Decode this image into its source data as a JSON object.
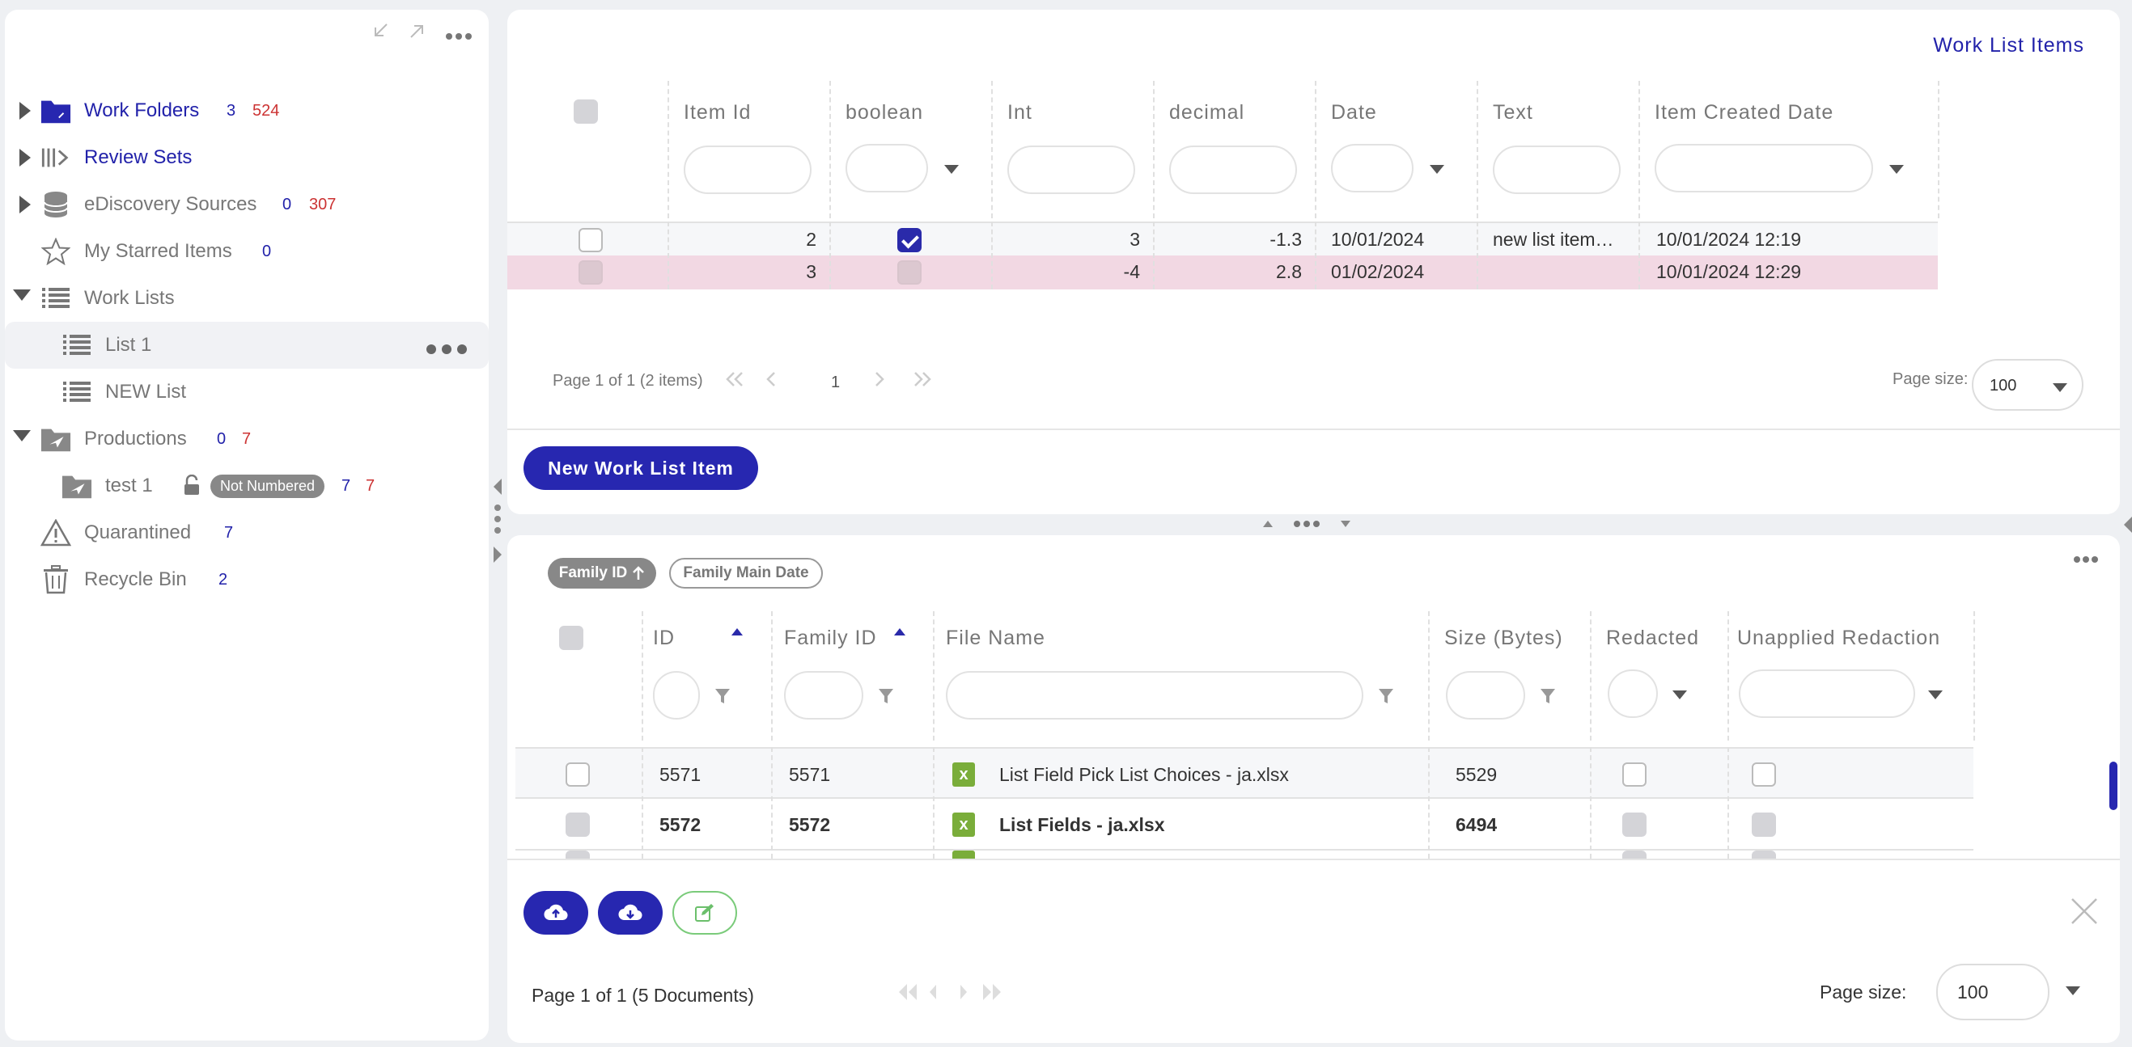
{
  "sidebar": {
    "top_icons": [
      "collapse-icon",
      "expand-icon",
      "more-icon"
    ],
    "items": [
      {
        "label": "Work Folders",
        "count_blue": "3",
        "count_red": "524"
      },
      {
        "label": "Review Sets"
      },
      {
        "label": "eDiscovery Sources",
        "count_blue": "0",
        "count_red": "307"
      },
      {
        "label": "My Starred Items",
        "count_blue": "0"
      },
      {
        "label": "Work Lists"
      },
      {
        "label": "List 1"
      },
      {
        "label": "NEW List"
      },
      {
        "label": "Productions",
        "count_blue": "0",
        "count_red": "7"
      },
      {
        "label": "test 1",
        "badge": "Not Numbered",
        "count_blue": "7",
        "count_red": "7"
      },
      {
        "label": "Quarantined",
        "count_blue": "7"
      },
      {
        "label": "Recycle Bin",
        "count_blue": "2"
      }
    ]
  },
  "work_list": {
    "title": "Work List Items",
    "columns": [
      "Item Id",
      "boolean",
      "Int",
      "decimal",
      "Date",
      "Text",
      "Item Created Date"
    ],
    "rows": [
      {
        "item_id": "2",
        "boolean": true,
        "int": "3",
        "decimal": "-1.3",
        "date": "10/01/2024",
        "text": "new list item…",
        "created": "10/01/2024 12:19"
      },
      {
        "item_id": "3",
        "boolean": false,
        "int": "-4",
        "decimal": "2.8",
        "date": "01/02/2024",
        "text": "",
        "created": "10/01/2024 12:29"
      }
    ],
    "pager": {
      "summary": "Page 1 of 1 (2 items)",
      "page": "1",
      "size_label": "Page size:",
      "size_value": "100"
    },
    "new_button": "New Work List Item"
  },
  "documents": {
    "sort_chips": [
      "Family ID",
      "Family Main Date"
    ],
    "columns": [
      "ID",
      "Family ID",
      "File Name",
      "Size (Bytes)",
      "Redacted",
      "Unapplied Redaction"
    ],
    "rows": [
      {
        "id": "5571",
        "family_id": "5571",
        "file_name": "List Field Pick List Choices - ja.xlsx",
        "size": "5529"
      },
      {
        "id": "5572",
        "family_id": "5572",
        "file_name": "List Fields - ja.xlsx",
        "size": "6494"
      }
    ],
    "pager": {
      "summary": "Page 1 of 1 (5 Documents)",
      "size_label": "Page size:",
      "size_value": "100"
    }
  },
  "colors": {
    "accent": "#2727b0",
    "highlight_row": "#f2d8e3",
    "link_blue": "#2222aa",
    "count_red": "#cc3333"
  }
}
